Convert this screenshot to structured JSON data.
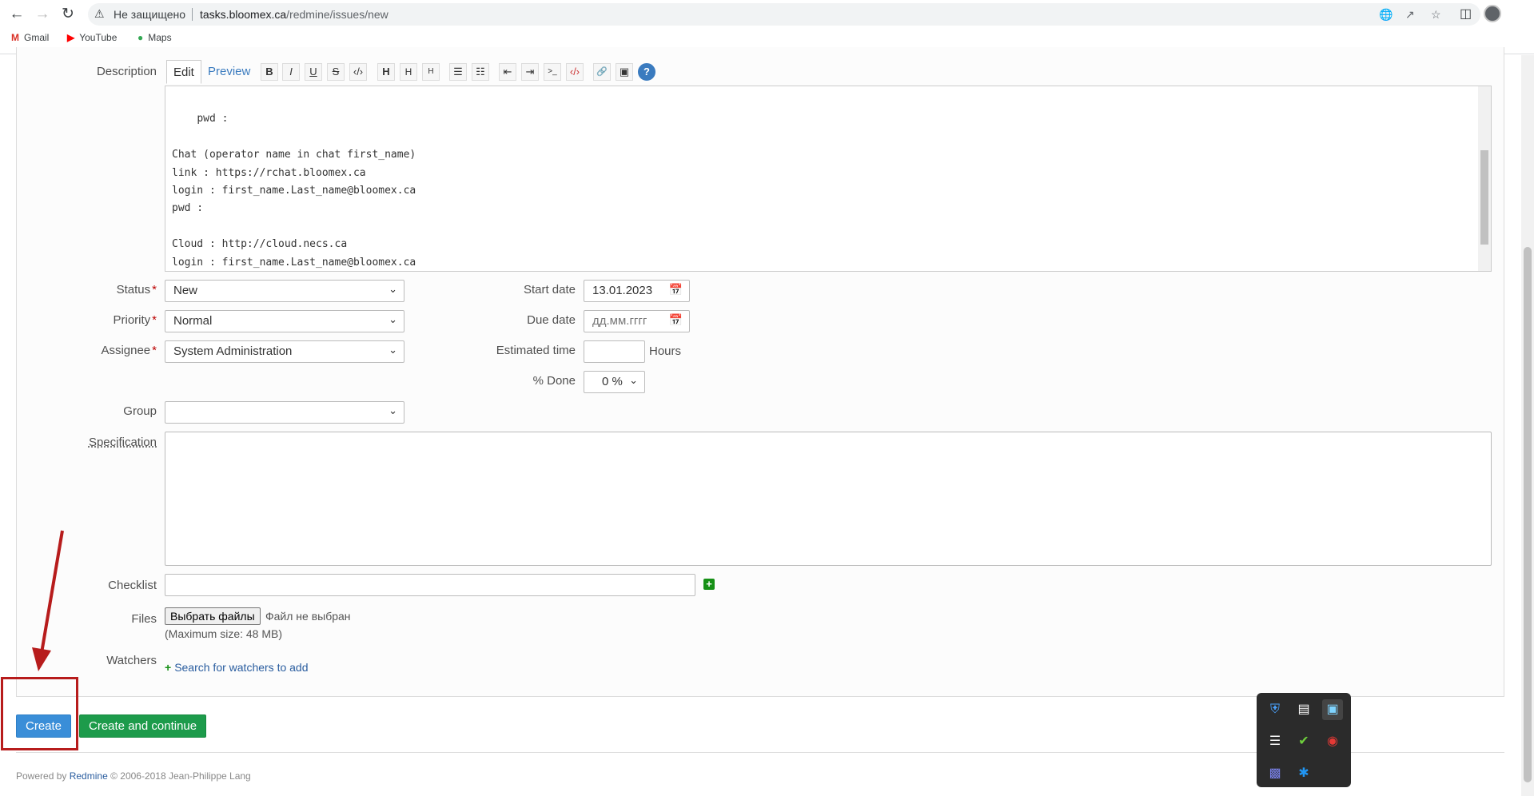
{
  "browser": {
    "insecure_label": "Не защищено",
    "url_host": "tasks.bloomex.ca",
    "url_path": "/redmine/issues/new",
    "bookmarks": [
      "Gmail",
      "YouTube",
      "Maps"
    ]
  },
  "editor": {
    "label": "Description",
    "tab_edit": "Edit",
    "tab_preview": "Preview",
    "toolbar": [
      "B",
      "I",
      "U",
      "S",
      "‹/›",
      "H",
      "H",
      "H",
      "☰",
      "☷",
      "⇤",
      "⇥",
      ">_",
      "‹/›",
      "🔗",
      "▣",
      "?"
    ],
    "content": "pwd :\n\nChat (operator name in chat first_name)\nlink : https://rchat.bloomex.ca\nlogin : first_name.Last_name@bloomex.ca\npwd :\n\nCloud : http://cloud.necs.ca\nlogin : first_name.Last_name@bloomex.ca\npwd :"
  },
  "form": {
    "status_label": "Status",
    "status_value": "New",
    "priority_label": "Priority",
    "priority_value": "Normal",
    "assignee_label": "Assignee",
    "assignee_value": "System Administration",
    "start_date_label": "Start date",
    "start_date_value": "13.01.2023",
    "due_date_label": "Due date",
    "due_date_placeholder": "дд.мм.гггг",
    "estimated_label": "Estimated time",
    "hours_label": "Hours",
    "done_label": "% Done",
    "done_value": "0 %",
    "group_label": "Group",
    "spec_label": "Specification",
    "checklist_label": "Checklist",
    "files_label": "Files",
    "file_button": "Выбрать файлы",
    "file_none": "Файл не выбран",
    "max_size": "(Maximum size: 48 MB)",
    "watchers_label": "Watchers",
    "watchers_link": "Search for watchers to add",
    "required_mark": "*"
  },
  "actions": {
    "create": "Create",
    "create_continue": "Create and continue"
  },
  "footer": {
    "powered": "Powered by",
    "redmine": "Redmine",
    "copy": "© 2006-2018 Jean-Philippe Lang"
  },
  "colors": {
    "create_button": "#3a8ed8",
    "continue_button": "#1d9b4b",
    "annotation": "#b71c1c"
  }
}
